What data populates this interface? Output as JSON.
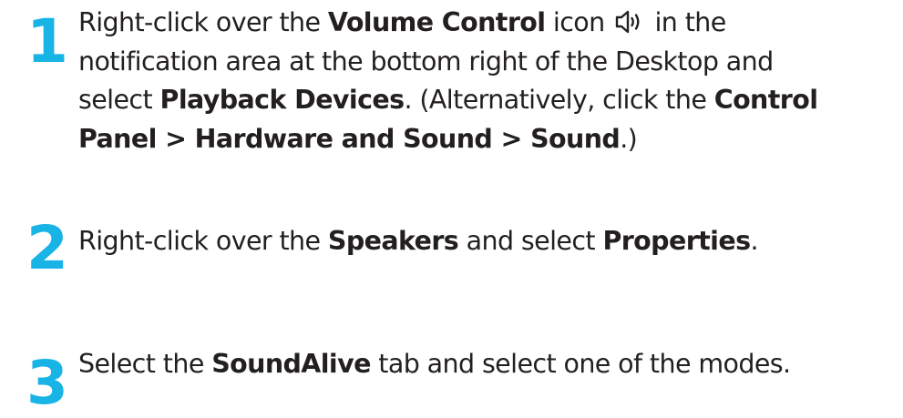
{
  "steps": [
    {
      "number": "1",
      "line1": {
        "t1": "Right-click over the ",
        "b1": "Volume Control",
        "t2": " icon ",
        "icon": "speaker-volume-icon",
        "t3": " in the"
      },
      "line2": "notification area at the bottom right of the Desktop and",
      "line3": {
        "t1": "select ",
        "b1": "Playback Devices",
        "t2": ". (Alternatively, click the ",
        "b2": "Control"
      },
      "line4": {
        "b1": "Panel > Hardware and Sound > Sound",
        "t1": ".)"
      }
    },
    {
      "number": "2",
      "t1": "Right-click over the ",
      "b1": "Speakers",
      "t2": " and select ",
      "b2": "Properties",
      "t3": "."
    },
    {
      "number": "3",
      "t1": "Select the ",
      "b1": "SoundAlive",
      "t2": " tab and select one of the modes."
    }
  ],
  "colors": {
    "step_number": "#19b4e6",
    "text": "#231f20"
  }
}
